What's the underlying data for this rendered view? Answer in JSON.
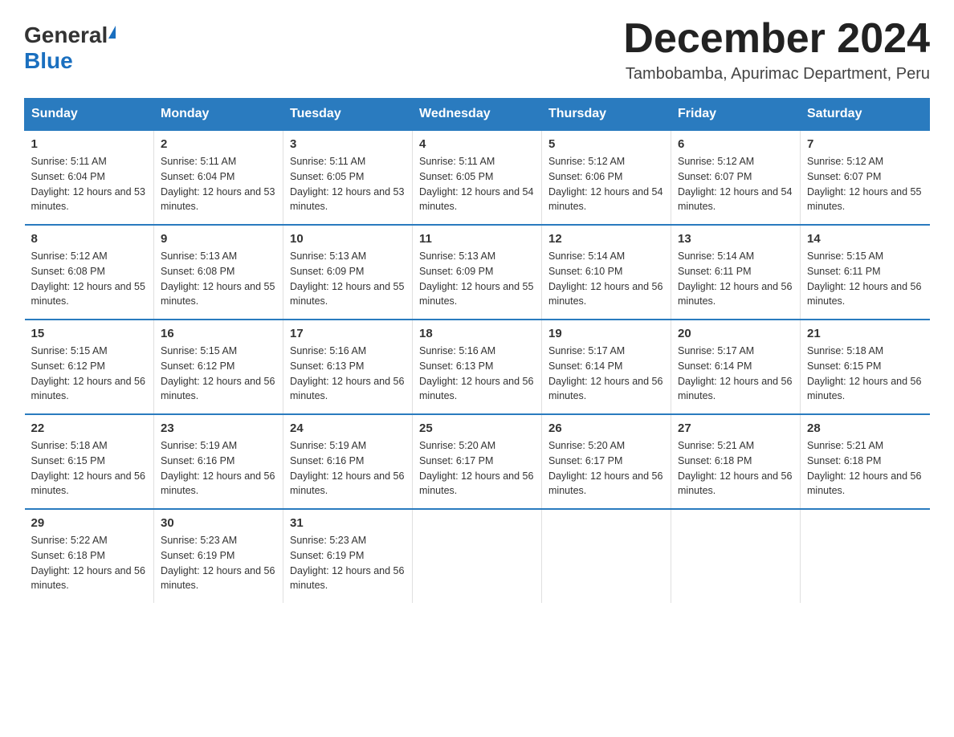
{
  "header": {
    "logo_general": "General",
    "logo_blue": "Blue",
    "month_title": "December 2024",
    "location": "Tambobamba, Apurimac Department, Peru"
  },
  "weekdays": [
    "Sunday",
    "Monday",
    "Tuesday",
    "Wednesday",
    "Thursday",
    "Friday",
    "Saturday"
  ],
  "weeks": [
    [
      {
        "day": "1",
        "sunrise": "5:11 AM",
        "sunset": "6:04 PM",
        "daylight": "12 hours and 53 minutes."
      },
      {
        "day": "2",
        "sunrise": "5:11 AM",
        "sunset": "6:04 PM",
        "daylight": "12 hours and 53 minutes."
      },
      {
        "day": "3",
        "sunrise": "5:11 AM",
        "sunset": "6:05 PM",
        "daylight": "12 hours and 53 minutes."
      },
      {
        "day": "4",
        "sunrise": "5:11 AM",
        "sunset": "6:05 PM",
        "daylight": "12 hours and 54 minutes."
      },
      {
        "day": "5",
        "sunrise": "5:12 AM",
        "sunset": "6:06 PM",
        "daylight": "12 hours and 54 minutes."
      },
      {
        "day": "6",
        "sunrise": "5:12 AM",
        "sunset": "6:07 PM",
        "daylight": "12 hours and 54 minutes."
      },
      {
        "day": "7",
        "sunrise": "5:12 AM",
        "sunset": "6:07 PM",
        "daylight": "12 hours and 55 minutes."
      }
    ],
    [
      {
        "day": "8",
        "sunrise": "5:12 AM",
        "sunset": "6:08 PM",
        "daylight": "12 hours and 55 minutes."
      },
      {
        "day": "9",
        "sunrise": "5:13 AM",
        "sunset": "6:08 PM",
        "daylight": "12 hours and 55 minutes."
      },
      {
        "day": "10",
        "sunrise": "5:13 AM",
        "sunset": "6:09 PM",
        "daylight": "12 hours and 55 minutes."
      },
      {
        "day": "11",
        "sunrise": "5:13 AM",
        "sunset": "6:09 PM",
        "daylight": "12 hours and 55 minutes."
      },
      {
        "day": "12",
        "sunrise": "5:14 AM",
        "sunset": "6:10 PM",
        "daylight": "12 hours and 56 minutes."
      },
      {
        "day": "13",
        "sunrise": "5:14 AM",
        "sunset": "6:11 PM",
        "daylight": "12 hours and 56 minutes."
      },
      {
        "day": "14",
        "sunrise": "5:15 AM",
        "sunset": "6:11 PM",
        "daylight": "12 hours and 56 minutes."
      }
    ],
    [
      {
        "day": "15",
        "sunrise": "5:15 AM",
        "sunset": "6:12 PM",
        "daylight": "12 hours and 56 minutes."
      },
      {
        "day": "16",
        "sunrise": "5:15 AM",
        "sunset": "6:12 PM",
        "daylight": "12 hours and 56 minutes."
      },
      {
        "day": "17",
        "sunrise": "5:16 AM",
        "sunset": "6:13 PM",
        "daylight": "12 hours and 56 minutes."
      },
      {
        "day": "18",
        "sunrise": "5:16 AM",
        "sunset": "6:13 PM",
        "daylight": "12 hours and 56 minutes."
      },
      {
        "day": "19",
        "sunrise": "5:17 AM",
        "sunset": "6:14 PM",
        "daylight": "12 hours and 56 minutes."
      },
      {
        "day": "20",
        "sunrise": "5:17 AM",
        "sunset": "6:14 PM",
        "daylight": "12 hours and 56 minutes."
      },
      {
        "day": "21",
        "sunrise": "5:18 AM",
        "sunset": "6:15 PM",
        "daylight": "12 hours and 56 minutes."
      }
    ],
    [
      {
        "day": "22",
        "sunrise": "5:18 AM",
        "sunset": "6:15 PM",
        "daylight": "12 hours and 56 minutes."
      },
      {
        "day": "23",
        "sunrise": "5:19 AM",
        "sunset": "6:16 PM",
        "daylight": "12 hours and 56 minutes."
      },
      {
        "day": "24",
        "sunrise": "5:19 AM",
        "sunset": "6:16 PM",
        "daylight": "12 hours and 56 minutes."
      },
      {
        "day": "25",
        "sunrise": "5:20 AM",
        "sunset": "6:17 PM",
        "daylight": "12 hours and 56 minutes."
      },
      {
        "day": "26",
        "sunrise": "5:20 AM",
        "sunset": "6:17 PM",
        "daylight": "12 hours and 56 minutes."
      },
      {
        "day": "27",
        "sunrise": "5:21 AM",
        "sunset": "6:18 PM",
        "daylight": "12 hours and 56 minutes."
      },
      {
        "day": "28",
        "sunrise": "5:21 AM",
        "sunset": "6:18 PM",
        "daylight": "12 hours and 56 minutes."
      }
    ],
    [
      {
        "day": "29",
        "sunrise": "5:22 AM",
        "sunset": "6:18 PM",
        "daylight": "12 hours and 56 minutes."
      },
      {
        "day": "30",
        "sunrise": "5:23 AM",
        "sunset": "6:19 PM",
        "daylight": "12 hours and 56 minutes."
      },
      {
        "day": "31",
        "sunrise": "5:23 AM",
        "sunset": "6:19 PM",
        "daylight": "12 hours and 56 minutes."
      },
      null,
      null,
      null,
      null
    ]
  ],
  "labels": {
    "sunrise": "Sunrise:",
    "sunset": "Sunset:",
    "daylight": "Daylight:"
  }
}
